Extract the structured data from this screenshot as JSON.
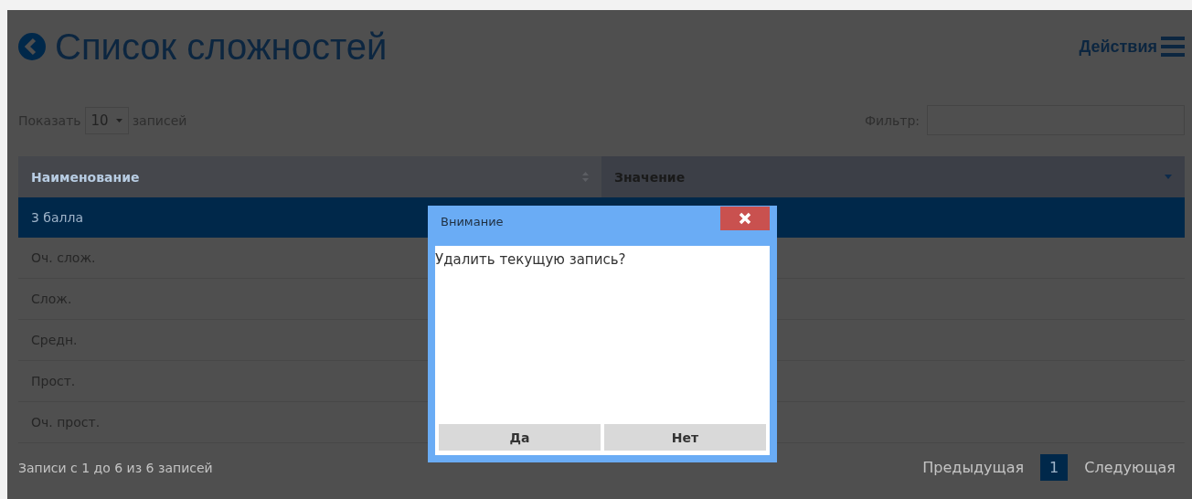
{
  "header": {
    "title": "Список сложностей",
    "actions": "Действия"
  },
  "length": {
    "label_before": "Показать",
    "value": "10",
    "label_after": "записей"
  },
  "filter": {
    "label": "Фильтр:"
  },
  "table": {
    "columns": [
      {
        "label": "Наименование",
        "kind": "unsorted"
      },
      {
        "label": "Значение",
        "kind": "descending"
      }
    ],
    "rows": [
      {
        "name": "3 балла",
        "selected": true
      },
      {
        "name": "Оч. слож.",
        "selected": false
      },
      {
        "name": "Слож.",
        "selected": false
      },
      {
        "name": "Средн.",
        "selected": false
      },
      {
        "name": "Прост.",
        "selected": false
      },
      {
        "name": "Оч. прост.",
        "selected": false
      }
    ]
  },
  "info": "Записи с 1 до 6 из 6 записей",
  "pagination": {
    "previous": "Предыдущая",
    "pages": [
      {
        "label": "1",
        "selected": true
      }
    ],
    "next": "Следующая"
  },
  "dialog": {
    "title": "Внимание",
    "message": "Удалить текущую запись?",
    "buttons": [
      "Да",
      "Нет"
    ]
  }
}
